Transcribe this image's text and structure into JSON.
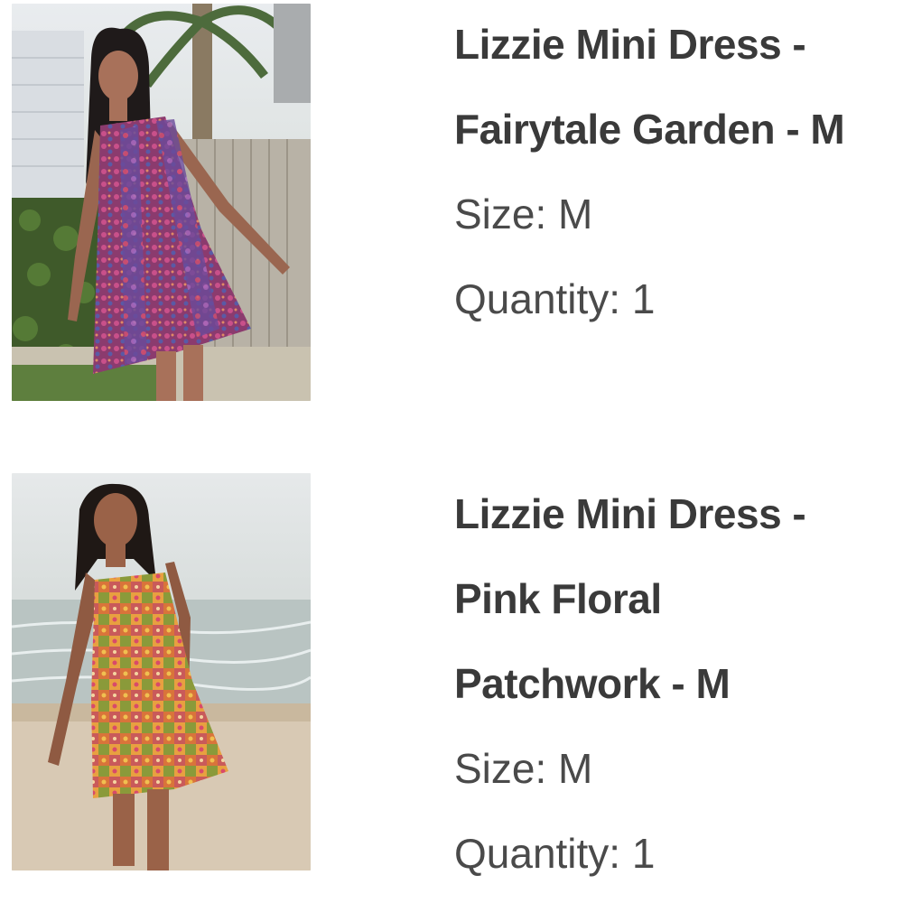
{
  "order_items": [
    {
      "title_lines": [
        "Lizzie Mini Dress -",
        "Fairytale Garden - M"
      ],
      "size": "Size: M",
      "quantity": "Quantity: 1",
      "image_icon": "product-photo-fairytale-garden"
    },
    {
      "title_lines": [
        "Lizzie Mini Dress -",
        "Pink Floral",
        "Patchwork - M"
      ],
      "size": "Size: M",
      "quantity": "Quantity: 1",
      "image_icon": "product-photo-pink-floral-patchwork"
    }
  ],
  "colors": {
    "title_text": "#3a3a3a",
    "meta_text": "#4a4a4a",
    "background": "#ffffff"
  }
}
